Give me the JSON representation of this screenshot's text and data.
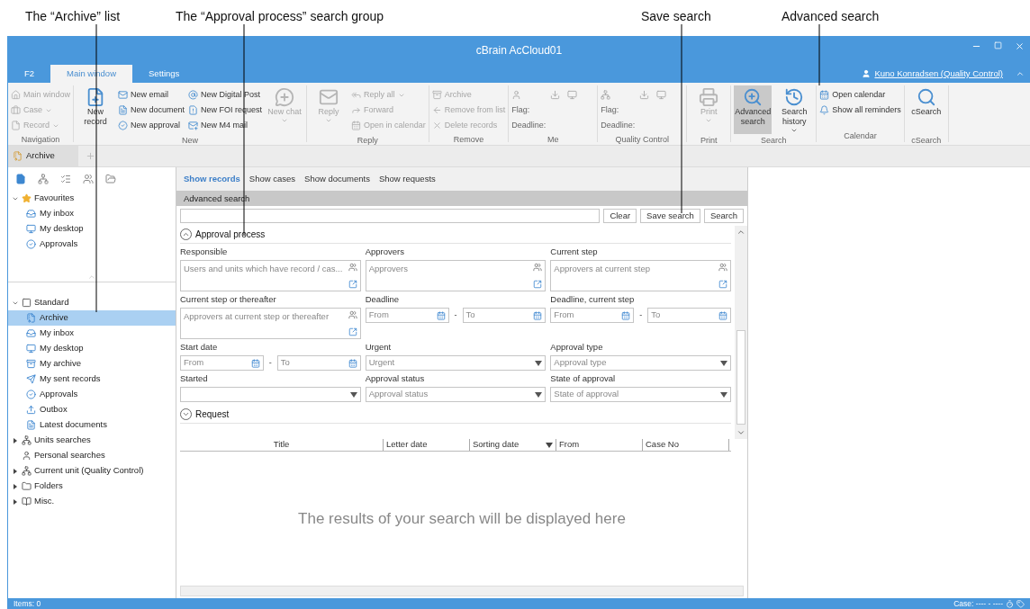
{
  "annotations": [
    {
      "label": "The “Archive” list"
    },
    {
      "label": "The “Approval process” search group"
    },
    {
      "label": "Save search"
    },
    {
      "label": "Advanced search"
    }
  ],
  "window": {
    "title": "cBrain AcCloud01",
    "menu_tab": "F2",
    "tabs": [
      {
        "label": "Main window",
        "selected": true
      },
      {
        "label": "Settings",
        "selected": false
      }
    ],
    "user": "Kuno Konradsen (Quality Control)"
  },
  "ribbon": [
    {
      "label": "Navigation",
      "kind": "buttons",
      "items": [
        {
          "label": "Main window",
          "kind": "small",
          "disabled": true
        },
        {
          "label": "Case",
          "kind": "small",
          "disabled": true,
          "dropdown": true
        },
        {
          "label": "Record",
          "kind": "small",
          "disabled": true,
          "dropdown": true
        }
      ]
    },
    {
      "label": "New",
      "kind": "buttons",
      "items": [
        {
          "label": "New record",
          "kind": "large",
          "disabled": false
        },
        {
          "label": "New email",
          "kind": "small",
          "disabled": false
        },
        {
          "label": "New document",
          "kind": "small",
          "disabled": false
        },
        {
          "label": "New approval",
          "kind": "small",
          "disabled": false
        },
        {
          "label": "New Digital Post",
          "kind": "small",
          "disabled": false
        },
        {
          "label": "New FOI request",
          "kind": "small",
          "disabled": false
        },
        {
          "label": "New M4 mail",
          "kind": "small",
          "disabled": false
        },
        {
          "label": "New chat",
          "kind": "large",
          "disabled": true,
          "dropdown": true
        }
      ]
    },
    {
      "label": "Reply",
      "kind": "buttons",
      "items": [
        {
          "label": "Reply",
          "kind": "large",
          "disabled": true,
          "dropdown": true
        },
        {
          "label": "Reply all",
          "kind": "small",
          "disabled": true,
          "dropdown": true
        },
        {
          "label": "Forward",
          "kind": "small",
          "disabled": true
        },
        {
          "label": "Open in calendar",
          "kind": "small",
          "disabled": true
        }
      ]
    },
    {
      "label": "Remove",
      "kind": "buttons",
      "items": [
        {
          "label": "Archive",
          "kind": "small",
          "disabled": true
        },
        {
          "label": "Remove from list",
          "kind": "small",
          "disabled": true
        },
        {
          "label": "Delete records",
          "kind": "small",
          "disabled": true
        }
      ]
    },
    {
      "label": "Me",
      "kind": "flags",
      "items": [
        {
          "label": "Flag:"
        },
        {
          "label": "Deadline:"
        }
      ]
    },
    {
      "label": "Quality Control",
      "kind": "flags",
      "items": [
        {
          "label": "Flag:"
        },
        {
          "label": "Deadline:"
        }
      ]
    },
    {
      "label": "Print",
      "kind": "buttons",
      "items": [
        {
          "label": "Print",
          "kind": "large",
          "disabled": true,
          "dropdown": true
        }
      ]
    },
    {
      "label": "Search",
      "kind": "buttons",
      "items": [
        {
          "label": "Advanced search",
          "kind": "large",
          "disabled": false,
          "selected": true
        },
        {
          "label": "Search history",
          "kind": "large",
          "disabled": false,
          "dropdown": true,
          "selected": false
        }
      ]
    },
    {
      "label": "Calendar",
      "kind": "buttons",
      "items": [
        {
          "label": "Open calendar",
          "kind": "small",
          "disabled": false
        },
        {
          "label": "Show all reminders",
          "kind": "small",
          "disabled": false
        }
      ]
    },
    {
      "label": "cSearch",
      "kind": "buttons",
      "items": [
        {
          "label": "cSearch",
          "kind": "large",
          "disabled": false
        }
      ]
    }
  ],
  "doc_tab": {
    "label": "Archive"
  },
  "sidebar": {
    "favourites": {
      "label": "Favourites",
      "expanded": true,
      "children": [
        {
          "label": "My inbox",
          "selected": false
        },
        {
          "label": "My desktop",
          "selected": false
        },
        {
          "label": "Approvals",
          "selected": false
        }
      ]
    },
    "tree": [
      {
        "label": "Standard",
        "expanded": true,
        "children": [
          {
            "label": "Archive",
            "selected": true
          },
          {
            "label": "My inbox",
            "selected": false
          },
          {
            "label": "My desktop",
            "selected": false
          },
          {
            "label": "My archive",
            "selected": false
          },
          {
            "label": "My sent records",
            "selected": false
          },
          {
            "label": "Approvals",
            "selected": false
          },
          {
            "label": "Outbox",
            "selected": false
          },
          {
            "label": "Latest documents",
            "selected": false
          }
        ]
      },
      {
        "label": "Units searches",
        "expanded": false
      },
      {
        "label": "Personal searches"
      },
      {
        "label": "Current unit (Quality Control)",
        "expanded": false
      },
      {
        "label": "Folders",
        "expanded": false
      },
      {
        "label": "Misc.",
        "expanded": false
      }
    ]
  },
  "view_tabs": [
    {
      "label": "Show records",
      "selected": true
    },
    {
      "label": "Show cases",
      "selected": false
    },
    {
      "label": "Show documents",
      "selected": false
    },
    {
      "label": "Show requests",
      "selected": false
    }
  ],
  "search": {
    "header": "Advanced search",
    "buttons": [
      "Clear",
      "Save search",
      "Search"
    ]
  },
  "groups": [
    {
      "label": "Approval process",
      "expanded": true,
      "fields": [
        {
          "label": "Responsible",
          "kind": "people",
          "placeholder": "Users and units which have record / cas..."
        },
        {
          "label": "Approvers",
          "kind": "people",
          "placeholder": "Approvers"
        },
        {
          "label": "Current step",
          "kind": "people",
          "placeholder": "Approvers at current step"
        },
        {
          "label": "Current step or thereafter",
          "kind": "people",
          "placeholder": "Approvers at current step or thereafter"
        },
        {
          "label": "Deadline",
          "kind": "range",
          "from": "From",
          "separator": "-",
          "to": "To"
        },
        {
          "label": "Deadline, current step",
          "kind": "range",
          "from": "From",
          "separator": "-",
          "to": "To"
        },
        {
          "label": "Start date",
          "kind": "range",
          "from": "From",
          "separator": "-",
          "to": "To"
        },
        {
          "label": "Urgent",
          "kind": "select",
          "placeholder": "Urgent"
        },
        {
          "label": "Approval type",
          "kind": "select",
          "placeholder": "Approval type"
        },
        {
          "label": "Started",
          "kind": "select"
        },
        {
          "label": "Approval status",
          "kind": "select",
          "placeholder": "Approval status"
        },
        {
          "label": "State of approval",
          "kind": "select",
          "placeholder": "State of approval"
        }
      ]
    },
    {
      "label": "Request",
      "expanded": false
    }
  ],
  "results": {
    "columns": [
      {
        "label": "Title",
        "sorted": false
      },
      {
        "label": "Letter date",
        "sorted": false
      },
      {
        "label": "Sorting date",
        "sorted": true
      },
      {
        "label": "From",
        "sorted": false
      },
      {
        "label": "Case No",
        "sorted": false
      }
    ],
    "empty_message": "The results of your search will be displayed here"
  },
  "status_bar": {
    "items": "Items: 0",
    "case": "Case: ---- - ----"
  }
}
